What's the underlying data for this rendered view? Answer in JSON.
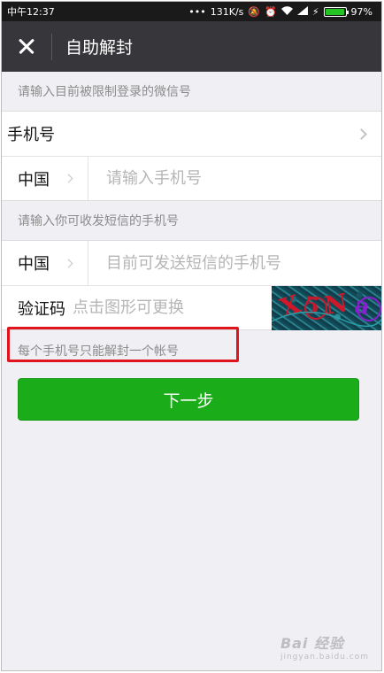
{
  "status_bar": {
    "time": "中午12:37",
    "dots": "•••",
    "network_speed": "131K/s",
    "battery": "97%",
    "battery_level": 0.97
  },
  "header": {
    "title": "自助解封"
  },
  "section1": {
    "label": "请输入目前被限制登录的微信号",
    "type_row_label": "手机号",
    "country": "中国",
    "phone_placeholder": "请输入手机号"
  },
  "section2": {
    "label": "请输入你可收发短信的手机号",
    "country": "中国",
    "phone_placeholder": "目前可发送短信的手机号",
    "code_label": "验证码",
    "code_placeholder": "点击图形可更换",
    "captcha_text": "X5Na"
  },
  "hint": "每个手机号只能解封一个帐号",
  "next_button": "下一步",
  "watermark": {
    "main": "Bai 经验",
    "sub": "jingyan.baidu.com"
  },
  "colors": {
    "primary": "#1aad19",
    "highlight": "#e0141d",
    "titlebar": "#37373b"
  }
}
